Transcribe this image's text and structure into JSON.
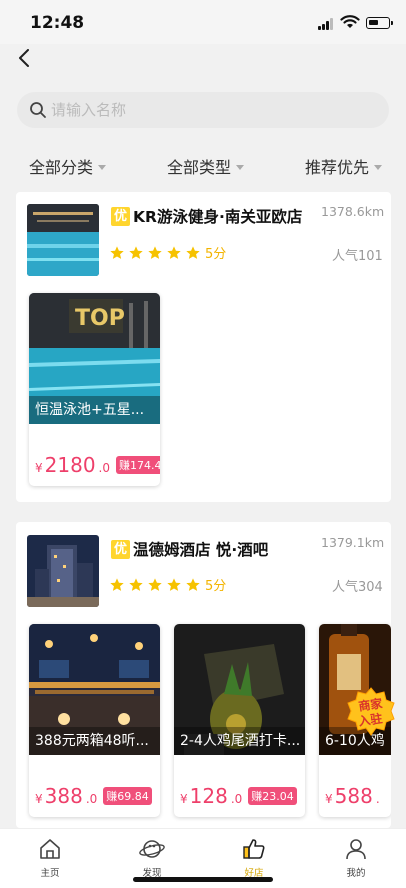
{
  "status": {
    "time": "12:48"
  },
  "search": {
    "placeholder": "请输入名称"
  },
  "filters": [
    "全部分类",
    "全部类型",
    "推荐优先"
  ],
  "shops": [
    {
      "tag": "优",
      "name": "KR游泳健身·南关亚欧店",
      "distance": "1378.6km",
      "score": "5分",
      "popularity": "人气101",
      "rating": 5,
      "items": [
        {
          "caption": "恒温泳池+五星...",
          "currency": "¥",
          "price": "2180",
          "decimal": ".0",
          "earn": "赚174.4"
        }
      ]
    },
    {
      "tag": "优",
      "name": "温德姆酒店 悦·酒吧",
      "distance": "1379.1km",
      "score": "5分",
      "popularity": "人气304",
      "rating": 5,
      "items": [
        {
          "caption": "388元两箱48听...",
          "currency": "¥",
          "price": "388",
          "decimal": ".0",
          "earn": "赚69.84"
        },
        {
          "caption": "2-4人鸡尾酒打卡...",
          "currency": "¥",
          "price": "128",
          "decimal": ".0",
          "earn": "赚23.04"
        },
        {
          "caption": "6-10人鸡",
          "currency": "¥",
          "price": "588",
          "decimal": ".",
          "earn": ""
        }
      ]
    }
  ],
  "badge": {
    "line1": "商家",
    "line2": "入驻"
  },
  "tabbar": [
    {
      "label": "主页",
      "icon": "home-icon"
    },
    {
      "label": "发现",
      "icon": "planet-icon"
    },
    {
      "label": "好店",
      "icon": "thumbs-up-icon",
      "active": true
    },
    {
      "label": "我的",
      "icon": "user-icon"
    }
  ],
  "colors": {
    "accent": "#ffd52e",
    "price": "#ee3f6a",
    "active_tab": "#d4a500"
  }
}
